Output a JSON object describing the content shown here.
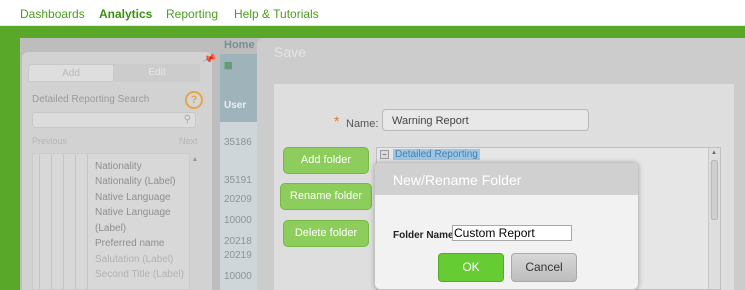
{
  "topnav": {
    "items": [
      {
        "label": "Dashboards",
        "active": false
      },
      {
        "label": "Analytics",
        "active": true
      },
      {
        "label": "Reporting",
        "active": false
      },
      {
        "label": "Help & Tutorials",
        "active": false
      }
    ]
  },
  "left_panel": {
    "tabs": [
      "Add",
      "Edit"
    ],
    "search_label": "Detailed Reporting Search",
    "help_icon": "?",
    "prev_label": "Previous",
    "next_label": "Next",
    "tree_items": [
      {
        "label": "Nationality",
        "faded": false
      },
      {
        "label": "Nationality (Label)",
        "faded": false
      },
      {
        "label": "Native Language",
        "faded": false
      },
      {
        "label": "Native Language",
        "faded": false
      },
      {
        "label": "(Label)",
        "faded": false
      },
      {
        "label": "Preferred name",
        "faded": false
      },
      {
        "label": "Salutation (Label)",
        "faded": true
      },
      {
        "label": "Second Title (Label)",
        "faded": true
      }
    ]
  },
  "results": {
    "breadcrumb": "Home",
    "column_header": "User",
    "cells": [
      "35186",
      "35191",
      "20209",
      "10000",
      "20218",
      "20219",
      "10000"
    ]
  },
  "save_dialog": {
    "title": "Save",
    "required_marker": "*",
    "name_label": "Name:",
    "name_value": "Warning Report",
    "buttons": {
      "add_folder": "Add folder",
      "rename_folder": "Rename folder",
      "delete_folder": "Delete folder"
    },
    "folder_tree_root": "Detailed Reporting",
    "tree_toggle": "−"
  },
  "rename_dialog": {
    "title": "New/Rename Folder",
    "folder_name_label": "Folder Name:",
    "folder_name_value": "Custom Report",
    "ok_label": "OK",
    "cancel_label": "Cancel"
  },
  "colors": {
    "brand_green": "#59a82a",
    "nav_text": "#4a9d1f",
    "ok_button": "#66cc33",
    "required_star": "#e07a2a"
  }
}
